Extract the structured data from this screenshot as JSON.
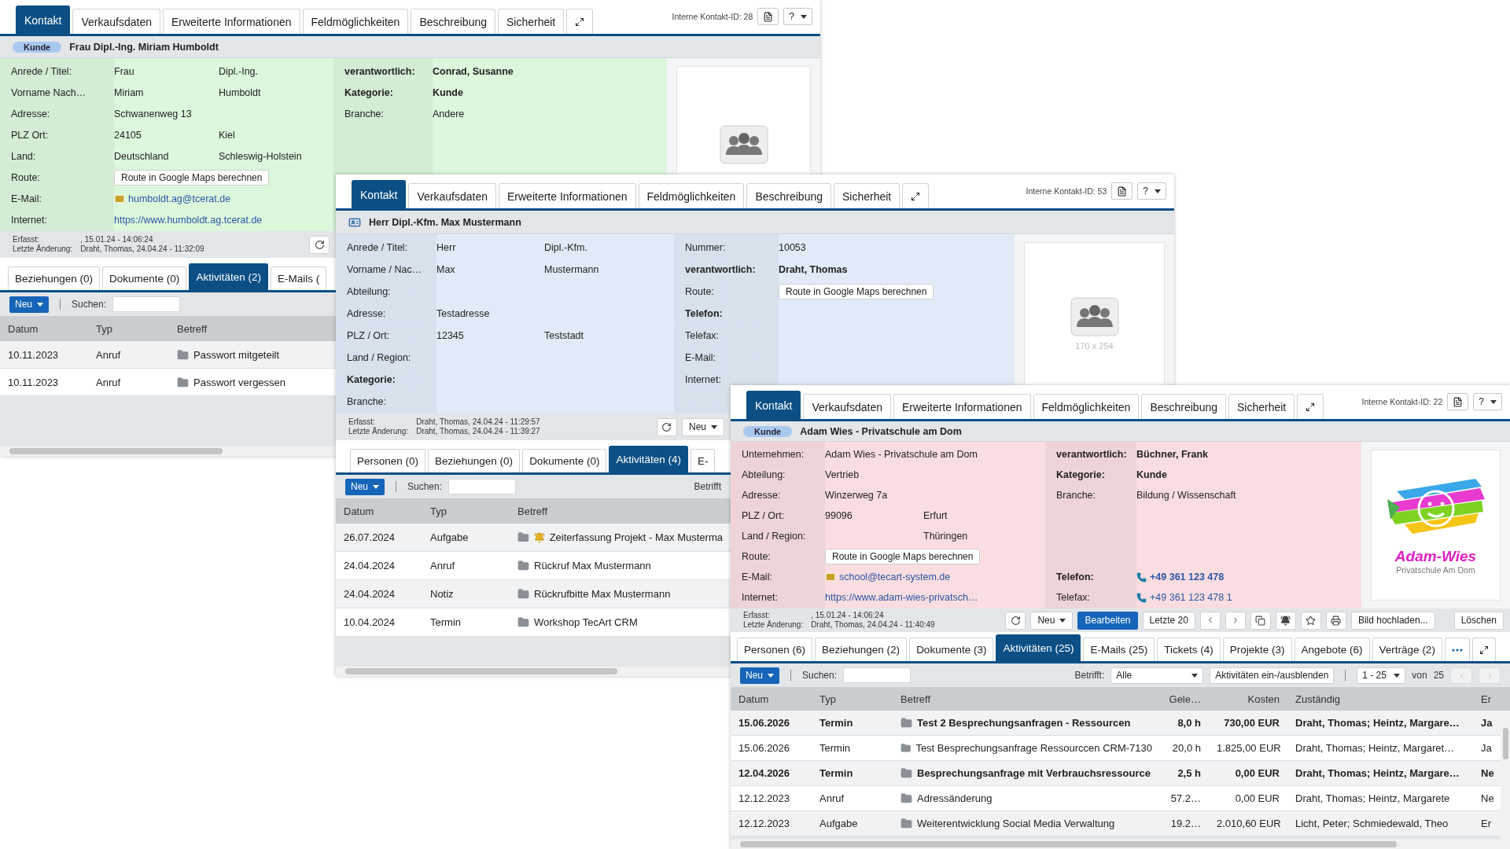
{
  "windows": [
    {
      "contact_id": "Interne Kontakt-ID: 28",
      "help": "?",
      "color": "#dcf7dc",
      "tabs": [
        {
          "label": "Kontakt",
          "selected": true
        },
        {
          "label": "Verkaufsdaten",
          "selected": false
        },
        {
          "label": "Erweiterte Informationen",
          "selected": false
        },
        {
          "label": "Feldmöglichkeiten",
          "selected": false
        },
        {
          "label": "Beschreibung",
          "selected": false
        },
        {
          "label": "Sicherheit",
          "selected": false
        }
      ],
      "header": {
        "kind": "badge",
        "badge": "Kunde",
        "title": "Frau Dipl.-Ing. Miriam Humboldt"
      },
      "left": [
        {
          "label": "Anrede / Titel:",
          "strong": false,
          "value": {
            "kind": "text",
            "text": "Frau"
          },
          "value_2": {
            "kind": "text",
            "text": "Dipl.-Ing."
          }
        },
        {
          "label": "Vorname Nach…",
          "strong": false,
          "value": {
            "kind": "text",
            "text": "Miriam"
          },
          "value_2": {
            "kind": "text",
            "text": "Humboldt"
          }
        },
        {
          "label": "Adresse:",
          "strong": false,
          "value": {
            "kind": "text",
            "text": "Schwanenweg 13"
          }
        },
        {
          "label": "PLZ Ort:",
          "strong": false,
          "value": {
            "kind": "text",
            "text": "24105"
          },
          "value_2": {
            "kind": "text",
            "text": "Kiel"
          }
        },
        {
          "label": "Land:",
          "strong": false,
          "value": {
            "kind": "text",
            "text": "Deutschland"
          },
          "value_2": {
            "kind": "text",
            "text": "Schleswig-Holstein"
          }
        },
        {
          "label": "Route:",
          "strong": false,
          "value": {
            "kind": "button",
            "text": "Route in Google Maps berechnen"
          }
        },
        {
          "label": "E-Mail:",
          "strong": false,
          "value": {
            "kind": "email",
            "text": "humboldt.ag@tcerat.de"
          }
        },
        {
          "label": "Internet:",
          "strong": false,
          "value": {
            "kind": "link",
            "text": "https://www.humboldt.ag.tcerat.de"
          }
        }
      ],
      "right": [
        {
          "label": "verantwortlich:",
          "strong": true,
          "value": {
            "kind": "text",
            "text": "Conrad, Susanne"
          }
        },
        {
          "label": "Kategorie:",
          "strong": true,
          "value": {
            "kind": "text",
            "text": "Kunde"
          }
        },
        {
          "label": "Branche:",
          "strong": false,
          "value": {
            "kind": "text",
            "text": "Andere"
          }
        }
      ],
      "photo": {
        "kind": "placeholder"
      },
      "footer": {
        "created_label": "Erfasst:",
        "created": ", 15.01.24 - 14:06:24",
        "changed_label": "Letzte Änderung:",
        "changed": "Draht, Thomas, 24.04.24 - 11:32:09",
        "actions": [
          {
            "kind": "refresh"
          }
        ]
      },
      "subtabs": [
        {
          "kind": "tab",
          "label": "Beziehungen (0)",
          "selected": false
        },
        {
          "kind": "tab",
          "label": "Dokumente (0)",
          "selected": false
        },
        {
          "kind": "tab",
          "label": "Aktivitäten (2)",
          "selected": true
        },
        {
          "kind": "tab",
          "label": "E-Mails (",
          "selected": false
        }
      ],
      "toolbar": {
        "new": "Neu",
        "search_label": "Suchen:"
      },
      "table": {
        "columns": [
          "Datum",
          "Typ",
          "Betreff"
        ],
        "rows": [
          {
            "unread": false,
            "reminder": false,
            "cells": [
              "10.11.2023",
              "Anruf",
              "Passwort mitgeteilt"
            ]
          },
          {
            "unread": false,
            "reminder": false,
            "cells": [
              "10.11.2023",
              "Anruf",
              "Passwort vergessen"
            ]
          }
        ]
      }
    },
    {
      "contact_id": "Interne Kontakt-ID: 53",
      "help": "?",
      "color": "#e1ebf7",
      "tabs": [
        {
          "label": "Kontakt",
          "selected": true
        },
        {
          "label": "Verkaufsdaten",
          "selected": false
        },
        {
          "label": "Erweiterte Informationen",
          "selected": false
        },
        {
          "label": "Feldmöglichkeiten",
          "selected": false
        },
        {
          "label": "Beschreibung",
          "selected": false
        },
        {
          "label": "Sicherheit",
          "selected": false
        }
      ],
      "header": {
        "kind": "card",
        "title": "Herr Dipl.-Kfm. Max Mustermann"
      },
      "left": [
        {
          "label": "Anrede / Titel:",
          "strong": false,
          "value": {
            "kind": "text",
            "text": "Herr"
          },
          "value_2": {
            "kind": "text",
            "text": "Dipl.-Kfm."
          }
        },
        {
          "label": "Vorname / Nac…",
          "strong": false,
          "value": {
            "kind": "text",
            "text": "Max"
          },
          "value_2": {
            "kind": "text",
            "text": "Mustermann"
          }
        },
        {
          "label": "Abteilung:",
          "strong": false
        },
        {
          "label": "Adresse:",
          "strong": false,
          "value": {
            "kind": "text",
            "text": "Testadresse"
          }
        },
        {
          "label": "PLZ / Ort:",
          "strong": false,
          "value": {
            "kind": "text",
            "text": "12345"
          },
          "value_2": {
            "kind": "text",
            "text": "Teststadt"
          }
        },
        {
          "label": "Land / Region:",
          "strong": false
        },
        {
          "label": "Kategorie:",
          "strong": true
        },
        {
          "label": "Branche:",
          "strong": false
        }
      ],
      "right": [
        {
          "label": "Nummer:",
          "strong": false,
          "value": {
            "kind": "text",
            "text": "10053"
          }
        },
        {
          "label": "verantwortlich:",
          "strong": true,
          "value": {
            "kind": "text",
            "text": "Draht, Thomas"
          }
        },
        {
          "label": "Route:",
          "strong": false,
          "value": {
            "kind": "button",
            "text": "Route in Google Maps berechnen"
          }
        },
        {
          "label": "Telefon:",
          "strong": true
        },
        {
          "label": "Telefax:",
          "strong": false
        },
        {
          "label": "E-Mail:",
          "strong": false
        },
        {
          "label": "Internet:",
          "strong": false
        }
      ],
      "photo": {
        "kind": "placeholder",
        "caption": "170 x 254"
      },
      "footer": {
        "created_label": "Erfasst:",
        "created": "Draht, Thomas, 24.04.24 - 11:29:57",
        "changed_label": "Letzte Änderung:",
        "changed": "Draht, Thomas, 24.04.24 - 11:39:27",
        "actions": [
          {
            "kind": "refresh"
          },
          {
            "kind": "dropdown",
            "label": "Neu"
          }
        ]
      },
      "subtabs": [
        {
          "kind": "tab",
          "label": "Personen (0)",
          "selected": false
        },
        {
          "kind": "tab",
          "label": "Beziehungen (0)",
          "selected": false
        },
        {
          "kind": "tab",
          "label": "Dokumente (0)",
          "selected": false
        },
        {
          "kind": "tab",
          "label": "Aktivitäten (4)",
          "selected": true
        },
        {
          "kind": "tab",
          "label": "E-",
          "selected": false
        }
      ],
      "toolbar": {
        "new": "Neu",
        "search_label": "Suchen:",
        "filter_label": "Betrifft"
      },
      "table": {
        "columns": [
          "Datum",
          "Typ",
          "Betreff"
        ],
        "rows": [
          {
            "unread": false,
            "reminder": true,
            "cells": [
              "26.07.2024",
              "Aufgabe",
              "Zeiterfassung Projekt - Max Musterma"
            ]
          },
          {
            "unread": false,
            "reminder": false,
            "cells": [
              "24.04.2024",
              "Anruf",
              "Rückruf Max Mustermann"
            ]
          },
          {
            "unread": false,
            "reminder": false,
            "cells": [
              "24.04.2024",
              "Notiz",
              "Rückrufbitte Max Mustermann"
            ]
          },
          {
            "unread": false,
            "reminder": false,
            "cells": [
              "10.04.2024",
              "Termin",
              "Workshop TecArt CRM"
            ]
          }
        ]
      }
    },
    {
      "contact_id": "Interne Kontakt-ID: 22",
      "help": "?",
      "color": "#f9dde0",
      "tabs": [
        {
          "label": "Kontakt",
          "selected": true
        },
        {
          "label": "Verkaufsdaten",
          "selected": false
        },
        {
          "label": "Erweiterte Informationen",
          "selected": false
        },
        {
          "label": "Feldmöglichkeiten",
          "selected": false
        },
        {
          "label": "Beschreibung",
          "selected": false
        },
        {
          "label": "Sicherheit",
          "selected": false
        }
      ],
      "header": {
        "kind": "badge",
        "badge": "Kunde",
        "title": "Adam Wies - Privatschule am Dom"
      },
      "left": [
        {
          "label": "Unternehmen:",
          "strong": false,
          "value": {
            "kind": "text",
            "text": "Adam Wies - Privatschule am Dom"
          }
        },
        {
          "label": "Abteilung:",
          "strong": false,
          "value": {
            "kind": "text",
            "text": "Vertrieb"
          }
        },
        {
          "label": "Adresse:",
          "strong": false,
          "value": {
            "kind": "text",
            "text": "Winzerweg 7a"
          }
        },
        {
          "label": "PLZ / Ort:",
          "strong": false,
          "value": {
            "kind": "text",
            "text": "99096"
          },
          "value_2": {
            "kind": "text",
            "text": "Erfurt"
          }
        },
        {
          "label": "Land / Region:",
          "strong": false,
          "value_2": {
            "kind": "text",
            "text": "Thüringen"
          }
        },
        {
          "label": "Route:",
          "strong": false,
          "value": {
            "kind": "button",
            "text": "Route in Google Maps berechnen"
          }
        },
        {
          "label": "E-Mail:",
          "strong": false,
          "value": {
            "kind": "email",
            "text": "school@tecart-system.de"
          }
        },
        {
          "label": "Internet:",
          "strong": false,
          "value": {
            "kind": "link",
            "text": "https://www.adam-wies-privatsch…"
          }
        }
      ],
      "right": [
        {
          "label": "verantwortlich:",
          "strong": true,
          "value": {
            "kind": "text",
            "text": "Büchner, Frank"
          }
        },
        {
          "label": "Kategorie:",
          "strong": true,
          "value": {
            "kind": "text",
            "text": "Kunde"
          }
        },
        {
          "label": "Branche:",
          "strong": false,
          "value": {
            "kind": "text",
            "text": "Bildung / Wissenschaft"
          }
        }
      ],
      "right_lower": [
        {
          "label": "Telefon:",
          "strong": true,
          "value": {
            "kind": "phone",
            "text": "+49 361 123 478"
          }
        },
        {
          "label": "Telefax:",
          "strong": false,
          "value": {
            "kind": "phone",
            "text": "+49 361 123 478 1"
          }
        }
      ],
      "photo": {
        "kind": "logo",
        "title": "Adam-Wies",
        "subtitle": "Privatschule Am Dom"
      },
      "footer": {
        "created_label": "Erfasst:",
        "created": ", 15.01.24 - 14:06:24",
        "changed_label": "Letzte Änderung:",
        "changed": "Draht, Thomas, 24.04.24 - 11:40:49",
        "actions": [
          {
            "kind": "refresh"
          },
          {
            "kind": "dropdown",
            "label": "Neu"
          },
          {
            "kind": "primary",
            "label": "Bearbeiten"
          },
          {
            "kind": "text",
            "label": "Letzte 20"
          },
          {
            "kind": "prev"
          },
          {
            "kind": "next"
          },
          {
            "kind": "copy"
          },
          {
            "kind": "bell"
          },
          {
            "kind": "star"
          },
          {
            "kind": "print"
          },
          {
            "kind": "text",
            "label": "Bild hochladen..."
          }
        ],
        "end_actions": [
          {
            "kind": "text",
            "label": "Löschen"
          }
        ]
      },
      "subtabs": [
        {
          "kind": "tab",
          "label": "Personen (6)",
          "selected": false
        },
        {
          "kind": "tab",
          "label": "Beziehungen (2)",
          "selected": false
        },
        {
          "kind": "tab",
          "label": "Dokumente (3)",
          "selected": false
        },
        {
          "kind": "tab",
          "label": "Aktivitäten (25)",
          "selected": true
        },
        {
          "kind": "tab",
          "label": "E-Mails (25)",
          "selected": false
        },
        {
          "kind": "tab",
          "label": "Tickets (4)",
          "selected": false
        },
        {
          "kind": "tab",
          "label": "Projekte (3)",
          "selected": false
        },
        {
          "kind": "tab",
          "label": "Angebote (6)",
          "selected": false
        },
        {
          "kind": "tab",
          "label": "Verträge (2)",
          "selected": false
        },
        {
          "kind": "more",
          "selected": false
        }
      ],
      "subtabs_expand": true,
      "toolbar": {
        "new": "Neu",
        "search_label": "Suchen:",
        "filter_label": "Betrifft:",
        "filter": "Alle",
        "toggle": "Aktivitäten ein-/ausblenden",
        "pager": "1 - 25",
        "pager_of": "von",
        "pager_total": "25"
      },
      "table": {
        "columns": [
          "Datum",
          "Typ",
          "Betreff",
          "Gele…",
          "Kosten",
          "Zuständig",
          "Er"
        ],
        "rows": [
          {
            "unread": true,
            "reminder": false,
            "cells": [
              "15.06.2026",
              "Termin",
              "Test 2 Besprechungsanfragen - Ressourcen",
              "8,0 h",
              "730,00 EUR",
              "Draht, Thomas; Heintz, Margare…",
              "Ja"
            ]
          },
          {
            "unread": false,
            "reminder": false,
            "cells": [
              "15.06.2026",
              "Termin",
              "Test Besprechungsanfrage Ressourccen CRM-7130",
              "20,0 h",
              "1.825,00 EUR",
              "Draht, Thomas; Heintz, Margaret…",
              "Ja"
            ]
          },
          {
            "unread": true,
            "reminder": false,
            "cells": [
              "12.04.2026",
              "Termin",
              "Besprechungsanfrage mit Verbrauchsressource",
              "2,5 h",
              "0,00 EUR",
              "Draht, Thomas; Heintz, Margare…",
              "Ne"
            ]
          },
          {
            "unread": false,
            "reminder": false,
            "cells": [
              "12.12.2023",
              "Anruf",
              "Adressänderung",
              "57.2…",
              "0,00 EUR",
              "Draht, Thomas; Heintz, Margarete",
              "Ne"
            ]
          },
          {
            "unread": false,
            "reminder": false,
            "cells": [
              "12.12.2023",
              "Aufgabe",
              "Weiterentwicklung Social Media Verwaltung",
              "19.2…",
              "2.010,60 EUR",
              "Licht, Peter; Schmiedewald, Theo",
              "Er"
            ]
          }
        ]
      }
    }
  ]
}
